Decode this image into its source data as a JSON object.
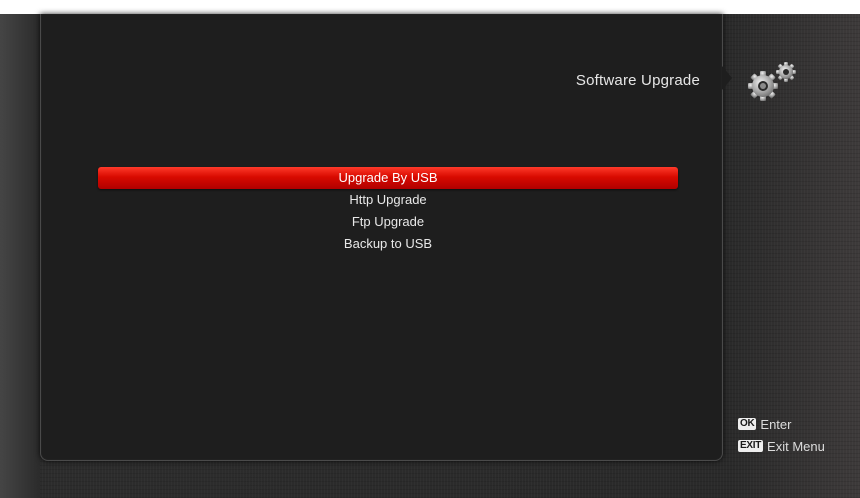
{
  "screen": {
    "title": "Software Upgrade",
    "icon": "gears-icon"
  },
  "menu": {
    "items": [
      {
        "label": "Upgrade By USB",
        "selected": true
      },
      {
        "label": "Http Upgrade",
        "selected": false
      },
      {
        "label": "Ftp Upgrade",
        "selected": false
      },
      {
        "label": "Backup to USB",
        "selected": false
      }
    ]
  },
  "hints": [
    {
      "key": "OK",
      "label": "Enter"
    },
    {
      "key": "EXIT",
      "label": "Exit Menu"
    }
  ],
  "colors": {
    "highlight": "#d80a00",
    "panel": "#1e1e1e",
    "text": "#e8e8e8"
  }
}
